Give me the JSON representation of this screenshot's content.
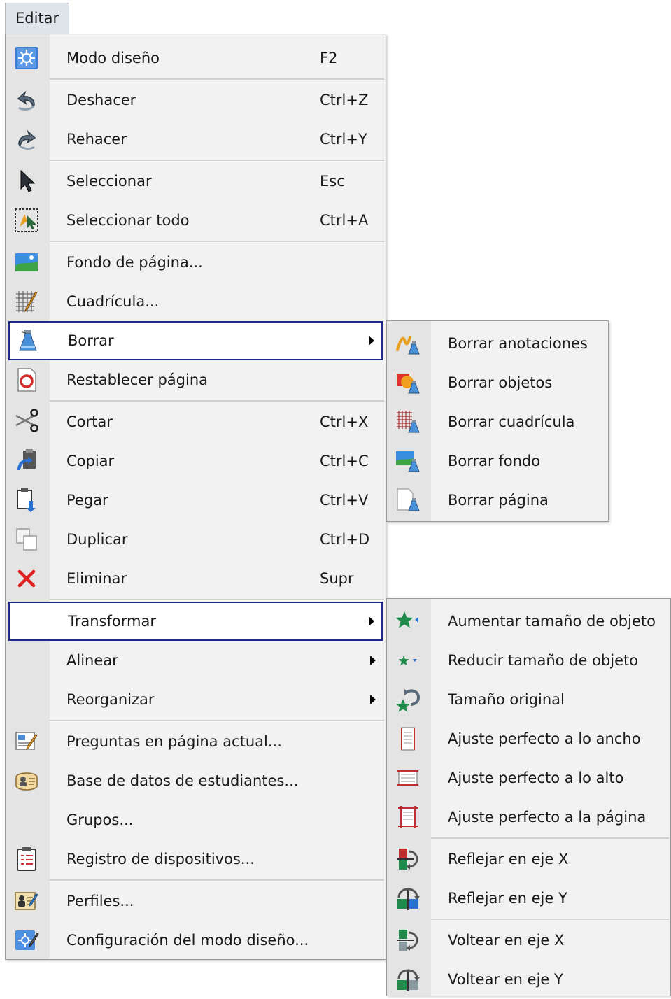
{
  "menubar": {
    "label": "Editar"
  },
  "main_menu": {
    "items": [
      {
        "label": "Modo diseño",
        "shortcut": "F2",
        "icon": "design-mode-icon"
      },
      {
        "label": "Deshacer",
        "shortcut": "Ctrl+Z",
        "icon": "undo-icon"
      },
      {
        "label": "Rehacer",
        "shortcut": "Ctrl+Y",
        "icon": "redo-icon"
      },
      {
        "label": "Seleccionar",
        "shortcut": "Esc",
        "icon": "pointer-icon"
      },
      {
        "label": "Seleccionar todo",
        "shortcut": "Ctrl+A",
        "icon": "select-all-icon"
      },
      {
        "label": "Fondo de página...",
        "shortcut": "",
        "icon": "background-icon"
      },
      {
        "label": "Cuadrícula...",
        "shortcut": "",
        "icon": "grid-icon"
      },
      {
        "label": "Borrar",
        "shortcut": "",
        "icon": "eraser-bottle-icon"
      },
      {
        "label": "Restablecer página",
        "shortcut": "",
        "icon": "reset-page-icon"
      },
      {
        "label": "Cortar",
        "shortcut": "Ctrl+X",
        "icon": "scissors-icon"
      },
      {
        "label": "Copiar",
        "shortcut": "Ctrl+C",
        "icon": "copy-icon"
      },
      {
        "label": "Pegar",
        "shortcut": "Ctrl+V",
        "icon": "paste-icon"
      },
      {
        "label": "Duplicar",
        "shortcut": "Ctrl+D",
        "icon": "duplicate-icon"
      },
      {
        "label": "Eliminar",
        "shortcut": "Supr",
        "icon": "delete-x-icon"
      },
      {
        "label": "Transformar",
        "shortcut": "",
        "icon": ""
      },
      {
        "label": "Alinear",
        "shortcut": "",
        "icon": ""
      },
      {
        "label": "Reorganizar",
        "shortcut": "",
        "icon": ""
      },
      {
        "label": "Preguntas en página actual...",
        "shortcut": "",
        "icon": "questions-icon"
      },
      {
        "label": "Base de datos de estudiantes...",
        "shortcut": "",
        "icon": "student-database-icon"
      },
      {
        "label": "Grupos...",
        "shortcut": "",
        "icon": ""
      },
      {
        "label": "Registro de dispositivos...",
        "shortcut": "",
        "icon": "clipboard-icon"
      },
      {
        "label": "Perfiles...",
        "shortcut": "",
        "icon": "profiles-icon"
      },
      {
        "label": "Configuración del modo diseño...",
        "shortcut": "",
        "icon": "design-settings-icon"
      }
    ]
  },
  "borrar_submenu": {
    "items": [
      {
        "label": "Borrar anotaciones",
        "icon": "clear-annotations-icon"
      },
      {
        "label": "Borrar objetos",
        "icon": "clear-objects-icon"
      },
      {
        "label": "Borrar cuadrícula",
        "icon": "clear-grid-icon"
      },
      {
        "label": "Borrar fondo",
        "icon": "clear-background-icon"
      },
      {
        "label": "Borrar página",
        "icon": "clear-page-icon"
      }
    ]
  },
  "transformar_submenu": {
    "items": [
      {
        "label": "Aumentar tamaño de objeto",
        "icon": "enlarge-star-icon"
      },
      {
        "label": "Reducir tamaño de objeto",
        "icon": "shrink-star-icon"
      },
      {
        "label": "Tamaño original",
        "icon": "original-size-icon"
      },
      {
        "label": "Ajuste perfecto a lo ancho",
        "icon": "fit-width-icon"
      },
      {
        "label": "Ajuste perfecto a lo alto",
        "icon": "fit-height-icon"
      },
      {
        "label": "Ajuste perfecto a la página",
        "icon": "fit-page-icon"
      },
      {
        "label": "Reflejar en eje X",
        "icon": "mirror-x-icon"
      },
      {
        "label": "Reflejar en eje Y",
        "icon": "mirror-y-icon"
      },
      {
        "label": "Voltear en eje X",
        "icon": "flip-x-icon"
      },
      {
        "label": "Voltear en eje Y",
        "icon": "flip-y-icon"
      }
    ]
  },
  "colors": {
    "highlight_border": "#1c2a8c",
    "menu_bg": "#f2f2f2",
    "gutter_bg": "#e4e4e4",
    "delete_red": "#e02020",
    "star_green": "#1f8a4c"
  }
}
